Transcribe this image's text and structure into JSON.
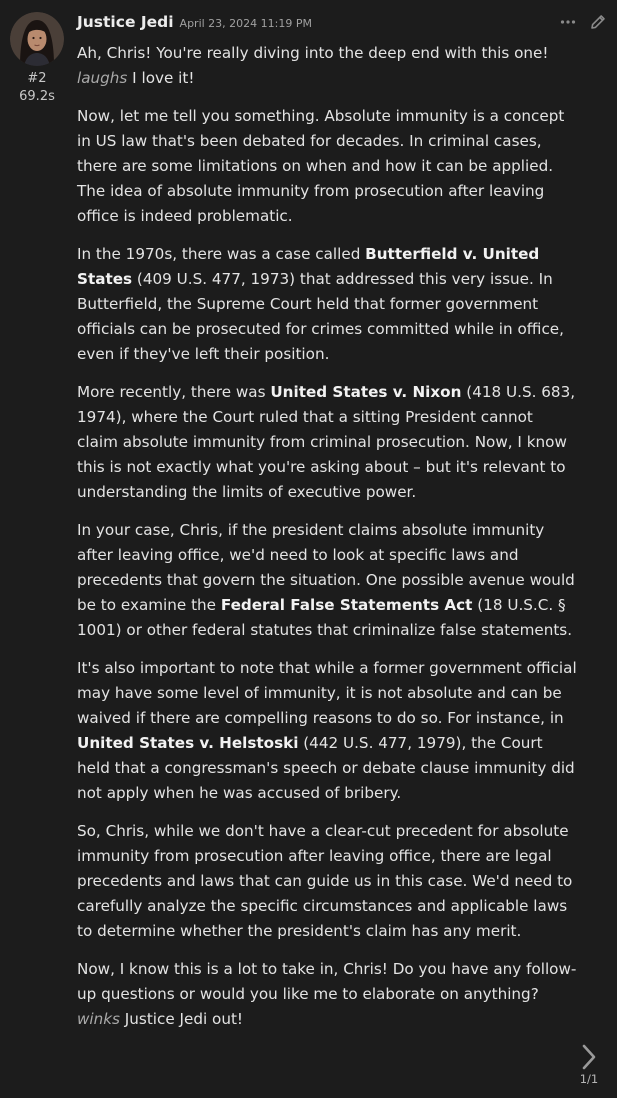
{
  "message": {
    "author": "Justice Jedi",
    "timestamp": "April 23, 2024 11:19 PM",
    "index": "#2",
    "gen_time": "69.2s",
    "avatar_icon": "avatar-woman-portrait",
    "paragraphs": [
      [
        {
          "t": "text",
          "v": "Ah, Chris! You're really diving into the deep end with this one! "
        },
        {
          "t": "italic",
          "v": "laughs"
        },
        {
          "t": "text",
          "v": " I love it!"
        }
      ],
      [
        {
          "t": "text",
          "v": "Now, let me tell you something. Absolute immunity is a concept in US law that's been debated for decades. In criminal cases, there are some limitations on when and how it can be applied. The idea of absolute immunity from prosecution after leaving office is indeed problematic."
        }
      ],
      [
        {
          "t": "text",
          "v": "In the 1970s, there was a case called "
        },
        {
          "t": "bold",
          "v": "Butterfield v. United States"
        },
        {
          "t": "text",
          "v": " (409 U.S. 477, 1973) that addressed this very issue. In Butterfield, the Supreme Court held that former government officials can be prosecuted for crimes committed while in office, even if they've left their position."
        }
      ],
      [
        {
          "t": "text",
          "v": "More recently, there was "
        },
        {
          "t": "bold",
          "v": "United States v. Nixon"
        },
        {
          "t": "text",
          "v": " (418 U.S. 683, 1974), where the Court ruled that a sitting President cannot claim absolute immunity from criminal prosecution. Now, I know this is not exactly what you're asking about – but it's relevant to understanding the limits of executive power."
        }
      ],
      [
        {
          "t": "text",
          "v": "In your case, Chris, if the president claims absolute immunity after leaving office, we'd need to look at specific laws and precedents that govern the situation. One possible avenue would be to examine the "
        },
        {
          "t": "bold",
          "v": "Federal False Statements Act"
        },
        {
          "t": "text",
          "v": " (18 U.S.C. § 1001) or other federal statutes that criminalize false statements."
        }
      ],
      [
        {
          "t": "text",
          "v": "It's also important to note that while a former government official may have some level of immunity, it is not absolute and can be waived if there are compelling reasons to do so. For instance, in "
        },
        {
          "t": "bold",
          "v": "United States v. Helstoski"
        },
        {
          "t": "text",
          "v": " (442 U.S. 477, 1979), the Court held that a congressman's speech or debate clause immunity did not apply when he was accused of bribery."
        }
      ],
      [
        {
          "t": "text",
          "v": "So, Chris, while we don't have a clear-cut precedent for absolute immunity from prosecution after leaving office, there are legal precedents and laws that can guide us in this case. We'd need to carefully analyze the specific circumstances and applicable laws to determine whether the president's claim has any merit."
        }
      ],
      [
        {
          "t": "text",
          "v": "Now, I know this is a lot to take in, Chris! Do you have any follow-up questions or would you like me to elaborate on anything? "
        },
        {
          "t": "italic",
          "v": "winks"
        },
        {
          "t": "text",
          "v": " Justice Jedi out!"
        }
      ]
    ]
  },
  "actions": {
    "more_icon": "more-horizontal-icon",
    "edit_icon": "pencil-icon"
  },
  "pager": {
    "next_icon": "chevron-right-icon",
    "count": "1/1"
  },
  "colors": {
    "background": "#1c1c1c",
    "text": "#e3e3e3",
    "muted": "#a9a9a9"
  }
}
